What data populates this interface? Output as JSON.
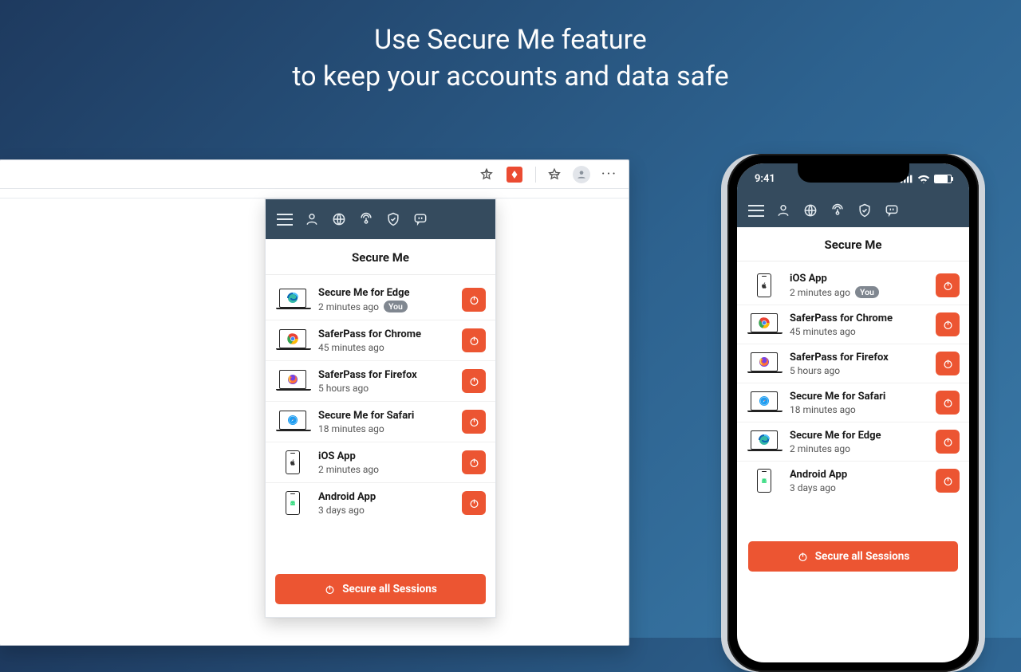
{
  "hero": {
    "line1": "Use Secure Me feature",
    "line2": "to keep your accounts and data safe"
  },
  "browser": {
    "toolbar": {
      "icons": [
        "star-outline-icon",
        "ext-badge",
        "divider",
        "star-half-icon",
        "avatar",
        "more-icon"
      ]
    },
    "panel": {
      "title": "Secure Me",
      "nav_icons": [
        "hamburger-icon",
        "person-icon",
        "globe-icon",
        "radar-icon",
        "shield-icon",
        "chat-icon"
      ],
      "sessions": [
        {
          "id": "edge",
          "name": "Secure Me for Edge",
          "time": "2 minutes ago",
          "you": true,
          "device": "laptop",
          "icon": "edge"
        },
        {
          "id": "chrome",
          "name": "SaferPass for Chrome",
          "time": "45 minutes ago",
          "you": false,
          "device": "laptop",
          "icon": "chrome"
        },
        {
          "id": "firefox",
          "name": "SaferPass for Firefox",
          "time": "5 hours ago",
          "you": false,
          "device": "laptop",
          "icon": "firefox"
        },
        {
          "id": "safari",
          "name": "Secure Me for Safari",
          "time": "18 minutes ago",
          "you": false,
          "device": "laptop",
          "icon": "safari"
        },
        {
          "id": "ios",
          "name": "iOS App",
          "time": "2 minutes ago",
          "you": false,
          "device": "phone",
          "icon": "apple"
        },
        {
          "id": "android",
          "name": "Android App",
          "time": "3 days ago",
          "you": false,
          "device": "phone",
          "icon": "android"
        }
      ],
      "you_label": "You",
      "secure_all_label": "Secure all Sessions"
    }
  },
  "phone": {
    "status_time": "9:41",
    "panel": {
      "title": "Secure Me",
      "nav_icons": [
        "hamburger-icon",
        "person-icon",
        "globe-icon",
        "radar-icon",
        "shield-icon",
        "chat-icon"
      ],
      "sessions": [
        {
          "id": "ios",
          "name": "iOS App",
          "time": "2 minutes ago",
          "you": true,
          "device": "phone",
          "icon": "apple"
        },
        {
          "id": "chrome",
          "name": "SaferPass for Chrome",
          "time": "45 minutes ago",
          "you": false,
          "device": "laptop",
          "icon": "chrome"
        },
        {
          "id": "firefox",
          "name": "SaferPass for Firefox",
          "time": "5 hours ago",
          "you": false,
          "device": "laptop",
          "icon": "firefox"
        },
        {
          "id": "safari",
          "name": "Secure Me for Safari",
          "time": "18 minutes ago",
          "you": false,
          "device": "laptop",
          "icon": "safari"
        },
        {
          "id": "edge",
          "name": "Secure Me for Edge",
          "time": "2 minutes ago",
          "you": false,
          "device": "laptop",
          "icon": "edge"
        },
        {
          "id": "android",
          "name": "Android App",
          "time": "3 days ago",
          "you": false,
          "device": "phone",
          "icon": "android"
        }
      ],
      "you_label": "You",
      "secure_all_label": "Secure all Sessions"
    }
  },
  "colors": {
    "accent": "#ec5532",
    "header": "#354b5e"
  }
}
